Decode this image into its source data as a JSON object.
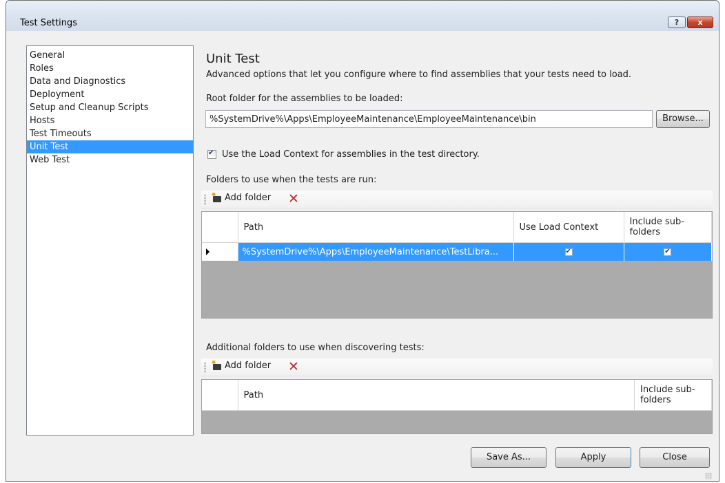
{
  "window": {
    "title": "Test Settings",
    "help_label": "?",
    "close_label": "x"
  },
  "nav": {
    "items": [
      "General",
      "Roles",
      "Data and Diagnostics",
      "Deployment",
      "Setup and Cleanup Scripts",
      "Hosts",
      "Test Timeouts",
      "Unit Test",
      "Web Test"
    ],
    "selected_index": 7
  },
  "panel": {
    "heading": "Unit Test",
    "subtitle": "Advanced options that let you configure where to find assemblies that your tests need to load.",
    "root_folder_label": "Root folder for the assemblies to be loaded:",
    "root_folder_value": "%SystemDrive%\\Apps\\EmployeeMaintenance\\EmployeeMaintenance\\bin",
    "browse_label": "Browse...",
    "load_context_label": "Use the Load Context for assemblies in the test directory.",
    "load_context_checked": true
  },
  "run_folders": {
    "label": "Folders to use when the tests are run:",
    "add_label": "Add folder",
    "columns": {
      "path": "Path",
      "use_load_context": "Use Load Context",
      "include_subfolders": "Include sub-folders"
    },
    "rows": [
      {
        "path": "%SystemDrive%\\Apps\\EmployeeMaintenance\\TestLibra...",
        "use_load_context": true,
        "include_subfolders": true
      }
    ]
  },
  "discover_folders": {
    "label": "Additional folders to use when discovering tests:",
    "add_label": "Add folder",
    "columns": {
      "path": "Path",
      "include_subfolders": "Include sub-folders"
    }
  },
  "footer": {
    "save_as_label": "Save As...",
    "apply_label": "Apply",
    "close_label": "Close"
  },
  "colors": {
    "selection": "#3399ff",
    "delete_icon": "#c1272d"
  },
  "icons": {
    "add_folder": "add-folder-icon",
    "delete": "delete-x-icon",
    "row_pointer": "row-arrow-icon"
  }
}
